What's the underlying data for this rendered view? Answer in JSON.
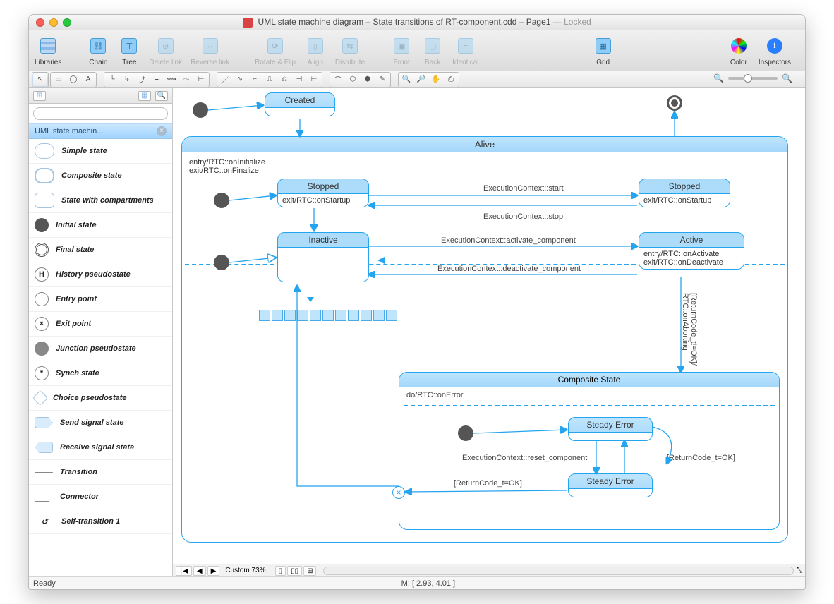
{
  "title": {
    "doc": "UML state machine diagram – State transitions of RT-component.cdd – Page1",
    "locked": "Locked"
  },
  "toolbar": {
    "libraries": "Libraries",
    "chain": "Chain",
    "tree": "Tree",
    "delete_link": "Delete link",
    "reverse_link": "Reverse link",
    "rotate_flip": "Rotate & Flip",
    "align": "Align",
    "distribute": "Distribute",
    "front": "Front",
    "back": "Back",
    "identical": "Identical",
    "grid": "Grid",
    "color": "Color",
    "inspectors": "Inspectors"
  },
  "lib": {
    "header": "UML state machin...",
    "items": [
      "Simple state",
      "Composite state",
      "State with compartments",
      "Initial state",
      "Final state",
      "History pseudostate",
      "Entry point",
      "Exit point",
      "Junction pseudostate",
      "Synch state",
      "Choice pseudostate",
      "Send signal state",
      "Receive signal state",
      "Transition",
      "Connector",
      "Self-transition 1"
    ]
  },
  "diagram": {
    "alive": "Alive",
    "created": "Created",
    "alive_entry": "entry/RTC::onInitialize",
    "alive_exit": "exit/RTC::onFinalize",
    "stopped": "Stopped",
    "stopped_body": "exit/RTC::onStartup",
    "ec_start": "ExecutionContext::start",
    "ec_stop": "ExecutionContext::stop",
    "inactive": "Inactive",
    "active": "Active",
    "active_entry": "entry/RTC::onActivate",
    "active_exit": "exit/RTC::onDeactivate",
    "ec_act": "ExecutionContext::activate_component",
    "ec_deact": "ExecutionContext::deactivate_component",
    "guard_rc": "[ReturnCode_t!=OK]/",
    "guard_rc2": "RTC::onAborting",
    "composite": "Composite State",
    "do_error": "do/RTC::onError",
    "steady1": "Steady Error",
    "steady2": "Steady Error",
    "ec_reset": "ExecutionContext::reset_component",
    "rc_ok": "[ReturnCode_t=OK]",
    "rc_ok2": "[ReturnCode_t=OK]"
  },
  "bottom": {
    "zoom": "Custom 73%",
    "ready": "Ready",
    "mouse": "M: [ 2.93, 4.01 ]"
  }
}
